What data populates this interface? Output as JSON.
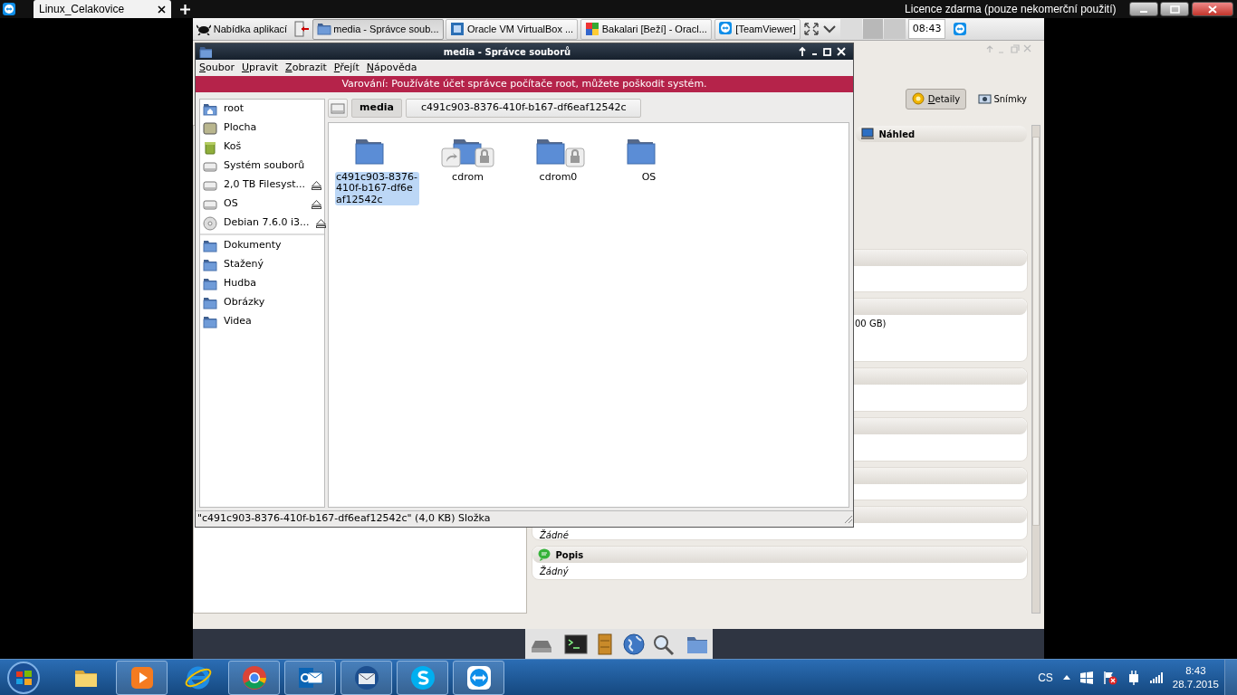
{
  "teamviewer_bar": {
    "tabs": [
      {
        "label": "Linux_Celakovice",
        "selected": true
      }
    ],
    "license": "Licence zdarma (pouze nekomerční použití)"
  },
  "panel": {
    "app_menu": "Nabídka aplikací",
    "tasks": [
      {
        "label": "media - Správce soub...",
        "kind": "file-manager",
        "selected": true
      },
      {
        "label": "Oracle VM VirtualBox ...",
        "kind": "virtualbox",
        "selected": false
      },
      {
        "label": "Bakalari [Beží] - Oracl...",
        "kind": "vm",
        "selected": false
      },
      {
        "label": "[TeamViewer]",
        "kind": "teamviewer",
        "selected": false
      }
    ],
    "clock": "08:43"
  },
  "file_manager": {
    "title": "media - Správce souborů",
    "menu": [
      "Soubor",
      "Upravit",
      "Zobrazit",
      "Přejít",
      "Nápověda"
    ],
    "warning": "Varování: Používáte účet správce počítače root, můžete poškodit systém.",
    "sidebar": {
      "places": [
        {
          "label": "root",
          "kind": "home",
          "eject": false
        },
        {
          "label": "Plocha",
          "kind": "desktop",
          "eject": false
        },
        {
          "label": "Koš",
          "kind": "trash",
          "eject": false
        },
        {
          "label": "Systém souborů",
          "kind": "drive",
          "eject": false
        },
        {
          "label": "2,0 TB Filesyst...",
          "kind": "drive",
          "eject": true
        },
        {
          "label": "OS",
          "kind": "drive",
          "eject": true
        },
        {
          "label": "Debian 7.6.0 i3...",
          "kind": "disc",
          "eject": true
        }
      ],
      "bookmarks": [
        {
          "label": "Dokumenty",
          "kind": "folder",
          "eject": false
        },
        {
          "label": "Stažený",
          "kind": "folder",
          "eject": false
        },
        {
          "label": "Hudba",
          "kind": "folder",
          "eject": false
        },
        {
          "label": "Obrázky",
          "kind": "folder",
          "eject": false
        },
        {
          "label": "Videa",
          "kind": "folder",
          "eject": false
        }
      ]
    },
    "path": [
      {
        "label": "media",
        "selected": true
      },
      {
        "label": "c491c903-8376-410f-b167-df6eaf12542c",
        "selected": false
      }
    ],
    "files": [
      {
        "name": "c491c903-8376-410f-b167-df6eaf12542c",
        "kind": "folder",
        "selected": true
      },
      {
        "name": "cdrom",
        "kind": "locked-link",
        "selected": false
      },
      {
        "name": "cdrom0",
        "kind": "locked",
        "selected": false
      },
      {
        "name": "OS",
        "kind": "folder",
        "selected": false
      }
    ],
    "status": "\"c491c903-8376-410f-b167-df6eaf12542c\" (4,0 KB) Složka"
  },
  "virtualbox": {
    "tabs": [
      {
        "label": "Detaily",
        "kind": "details",
        "selected": true
      },
      {
        "label": "Snímky",
        "kind": "snapshots",
        "selected": false
      }
    ],
    "sections": [
      {
        "title": "Náhled",
        "kind": "preview"
      },
      {
        "kind": "other"
      },
      {
        "kind": "other",
        "lines": [
          "00 GB)"
        ]
      },
      {
        "kind": "other"
      },
      {
        "kind": "other"
      },
      {
        "kind": "other"
      },
      {
        "kind": "other",
        "lines": [
          "Žádné"
        ]
      },
      {
        "title": "Popis",
        "kind": "description",
        "lines": [
          "Žádný"
        ]
      }
    ]
  },
  "dock": [
    {
      "kind": "drive"
    },
    {
      "kind": "terminal"
    },
    {
      "kind": "cabinet"
    },
    {
      "kind": "globe"
    },
    {
      "kind": "search"
    },
    {
      "kind": "folder"
    }
  ],
  "taskbar": {
    "apps": [
      {
        "kind": "explorer",
        "running": false
      },
      {
        "kind": "media-player",
        "running": true
      },
      {
        "kind": "browser-e",
        "running": false
      },
      {
        "kind": "browser-ring",
        "running": true
      },
      {
        "kind": "mail-square",
        "running": true
      },
      {
        "kind": "mail-bird",
        "running": true
      },
      {
        "kind": "chat",
        "running": true
      },
      {
        "kind": "remote",
        "running": true
      }
    ],
    "language": "CS",
    "time": "8:43",
    "date": "28.7.2015"
  }
}
